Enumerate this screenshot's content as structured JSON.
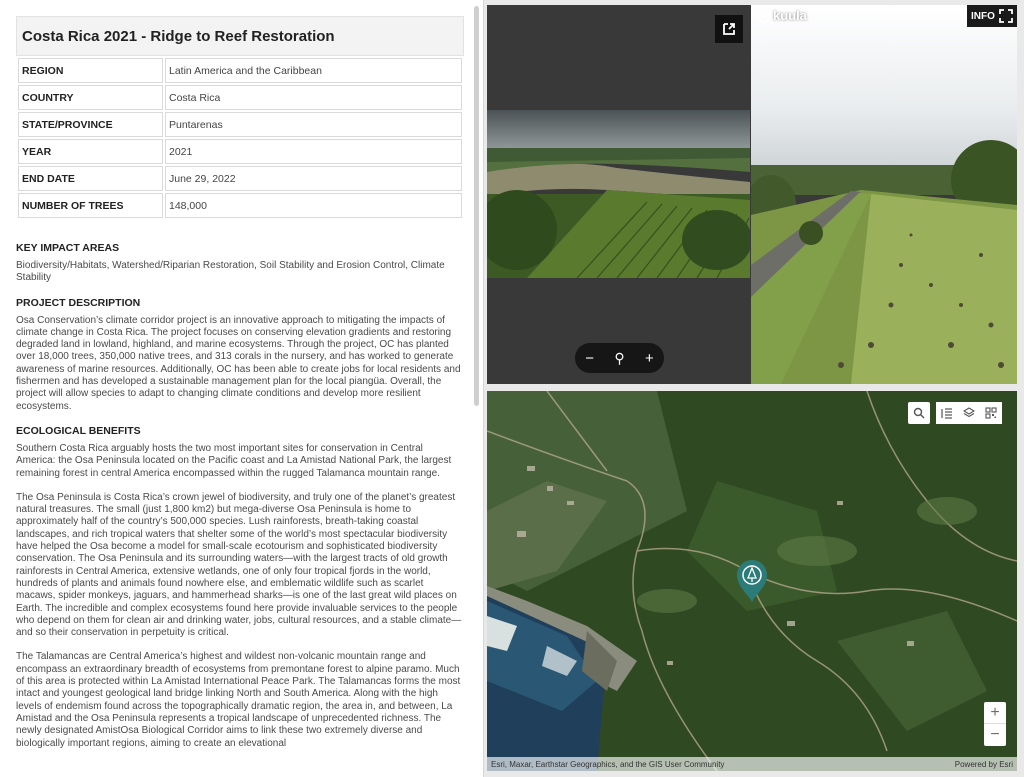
{
  "project": {
    "title": "Costa Rica 2021 - Ridge to Reef Restoration",
    "fields": [
      {
        "label": "REGION",
        "value": "Latin America and the Caribbean"
      },
      {
        "label": "COUNTRY",
        "value": "Costa Rica"
      },
      {
        "label": "STATE/PROVINCE",
        "value": "Puntarenas"
      },
      {
        "label": "YEAR",
        "value": "2021"
      },
      {
        "label": "END DATE",
        "value": "June 29, 2022"
      },
      {
        "label": "NUMBER OF TREES",
        "value": "148,000"
      }
    ],
    "key_impact": {
      "heading": "KEY IMPACT AREAS",
      "text": "Biodiversity/Habitats, Watershed/Riparian Restoration, Soil Stability and Erosion Control, Climate Stability"
    },
    "description": {
      "heading": "PROJECT DESCRIPTION",
      "text": "Osa Conservation’s climate corridor project is an innovative approach to mitigating the impacts of climate change in Costa Rica. The project focuses on conserving elevation gradients and restoring degraded land in lowland, highland, and marine ecosystems. Through the project, OC has planted over 18,000 trees, 350,000 native trees, and 313 corals in the nursery, and has worked to generate awareness of marine resources. Additionally, OC has been able to create jobs for local residents and fishermen and has developed a sustainable management plan for the local piangüa. Overall, the project will allow species to adapt to changing climate conditions and develop more resilient ecosystems."
    },
    "ecological": {
      "heading": "ECOLOGICAL BENEFITS",
      "p1": "Southern Costa Rica arguably hosts the two most important sites for conservation in Central America: the Osa Peninsula located on the Pacific coast and La Amistad National Park, the largest remaining forest in central America encompassed within the rugged Talamanca mountain range.",
      "p2": "The Osa Peninsula is Costa Rica’s crown jewel of biodiversity, and truly one of the planet’s greatest natural treasures. The small (just 1,800 km2) but mega-diverse Osa Peninsula is home to approximately half of the country’s 500,000 species. Lush rainforests, breath-taking coastal landscapes, and rich tropical waters that shelter some of the world’s most spectacular biodiversity have helped the Osa become a model for small-scale ecotourism and sophisticated biodiversity conservation. The Osa Peninsula and its surrounding waters—with the largest tracts of old growth rainforests in Central America, extensive wetlands, one of only four tropical fjords in the world, hundreds of plants and animals found nowhere else, and emblematic wildlife such as scarlet macaws, spider monkeys, jaguars, and hammerhead sharks—is one of the last great wild places on Earth. The incredible and complex ecosystems found here provide invaluable services to the people who depend on them for clean air and drinking water, jobs, cultural resources, and a stable climate—and so their conservation in perpetuity is critical.",
      "p3": "The Talamancas are Central America’s highest and wildest non-volcanic mountain range and encompass an extraordinary breadth of ecosystems from premontane forest to alpine paramo. Much of this area is protected within La Amistad International Peace Park. The Talamancas forms the most intact and youngest geological land bridge linking North and South America. Along with the high levels of endemism found across the topographically dramatic region, the area in, and between, La Amistad and the Osa Peninsula represents a tropical landscape of unprecedented richness. The newly designated AmistOsa Biological Corridor aims to link these two extremely diverse and biologically important regions, aiming to create an elevational"
    }
  },
  "viewer": {
    "brand": "kuula",
    "info_label": "INFO",
    "zoom_out": "−",
    "zoom_fit": "⚲",
    "zoom_in": "+"
  },
  "map": {
    "attribution": "Esri, Maxar, Earthstar Geographics, and the GIS User Community",
    "powered_by": "Powered by Esri",
    "zoom_in": "+",
    "zoom_out": "−"
  }
}
